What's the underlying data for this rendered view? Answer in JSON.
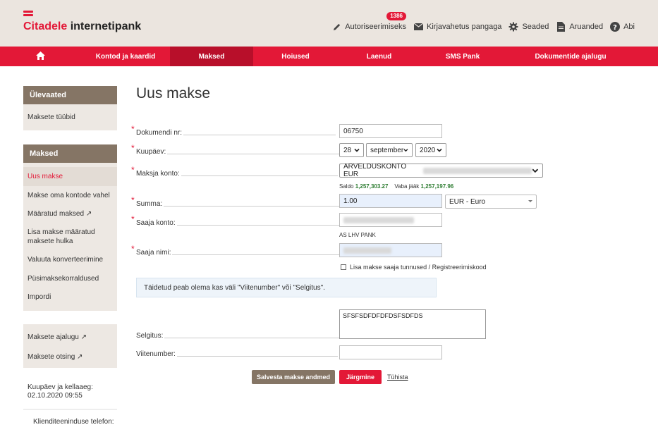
{
  "brand": {
    "name": "Citadele",
    "product": "internetipank",
    "color": "#e31837"
  },
  "top_links": [
    {
      "label": "Autoriseerimiseks",
      "icon": "pencil-icon",
      "badge": "1386"
    },
    {
      "label": "Kirjavahetus pangaga",
      "icon": "envelope-icon"
    },
    {
      "label": "Seaded",
      "icon": "gear-icon"
    },
    {
      "label": "Aruanded",
      "icon": "document-icon"
    },
    {
      "label": "Abi",
      "icon": "help-icon"
    }
  ],
  "nav": {
    "home_icon": "home-icon",
    "items": [
      {
        "label": "Kontod ja kaardid"
      },
      {
        "label": "Maksed",
        "active": true
      },
      {
        "label": "Hoiused"
      },
      {
        "label": "Laenud"
      },
      {
        "label": "SMS Pank"
      },
      {
        "label": "Dokumentide ajalugu"
      }
    ]
  },
  "sidebar": {
    "overview": {
      "title": "Ülevaated",
      "items": [
        "Maksete tüübid"
      ]
    },
    "payments": {
      "title": "Maksed",
      "items": [
        {
          "label": "Uus makse",
          "active": true
        },
        {
          "label": "Makse oma kontode vahel"
        },
        {
          "label": "Määratud maksed ↗"
        },
        {
          "label": "Lisa makse määratud maksete hulka"
        },
        {
          "label": "Valuuta konverteerimine"
        },
        {
          "label": "Püsimaksekorraldused"
        },
        {
          "label": "Impordi"
        }
      ]
    },
    "history": {
      "items": [
        "Maksete ajalugu ↗",
        "Maksete otsing ↗"
      ]
    },
    "datetime_label": "Kuupäev ja kellaaeg:",
    "datetime_value": "02.10.2020 09:55",
    "support_label": "Klienditeeninduse telefon:"
  },
  "form": {
    "title": "Uus makse",
    "doc_number": {
      "label": "Dokumendi nr:",
      "value": "06750"
    },
    "date": {
      "label": "Kuupäev:",
      "day": "28",
      "month": "september",
      "year": "2020"
    },
    "payer_account": {
      "label": "Maksja konto:",
      "value": "ARVELDUSKONTO EUR"
    },
    "balance": {
      "saldo_label": "Saldo",
      "saldo_value": "1,257,303.27",
      "free_label": "Vaba jääk",
      "free_value": "1,257,197.96"
    },
    "amount": {
      "label": "Summa:",
      "value": "1.00",
      "currency": "EUR - Euro"
    },
    "recipient_account": {
      "label": "Saaja konto:",
      "bank": "AS LHV PANK"
    },
    "recipient_name": {
      "label": "Saaja nimi:"
    },
    "add_identifiers": "Lisa makse saaja tunnused / Registreerimiskood",
    "info_message": "Täidetud peab olema kas väli \"Viitenumber\" või \"Selgitus\".",
    "explanation": {
      "label": "Selgitus:",
      "value": "SFSFSDFDFDFDSFSDFDS"
    },
    "reference": {
      "label": "Viitenumber:",
      "value": ""
    },
    "buttons": {
      "save": "Salvesta makse andmed",
      "next": "Järgmine",
      "cancel": "Tühista"
    }
  }
}
